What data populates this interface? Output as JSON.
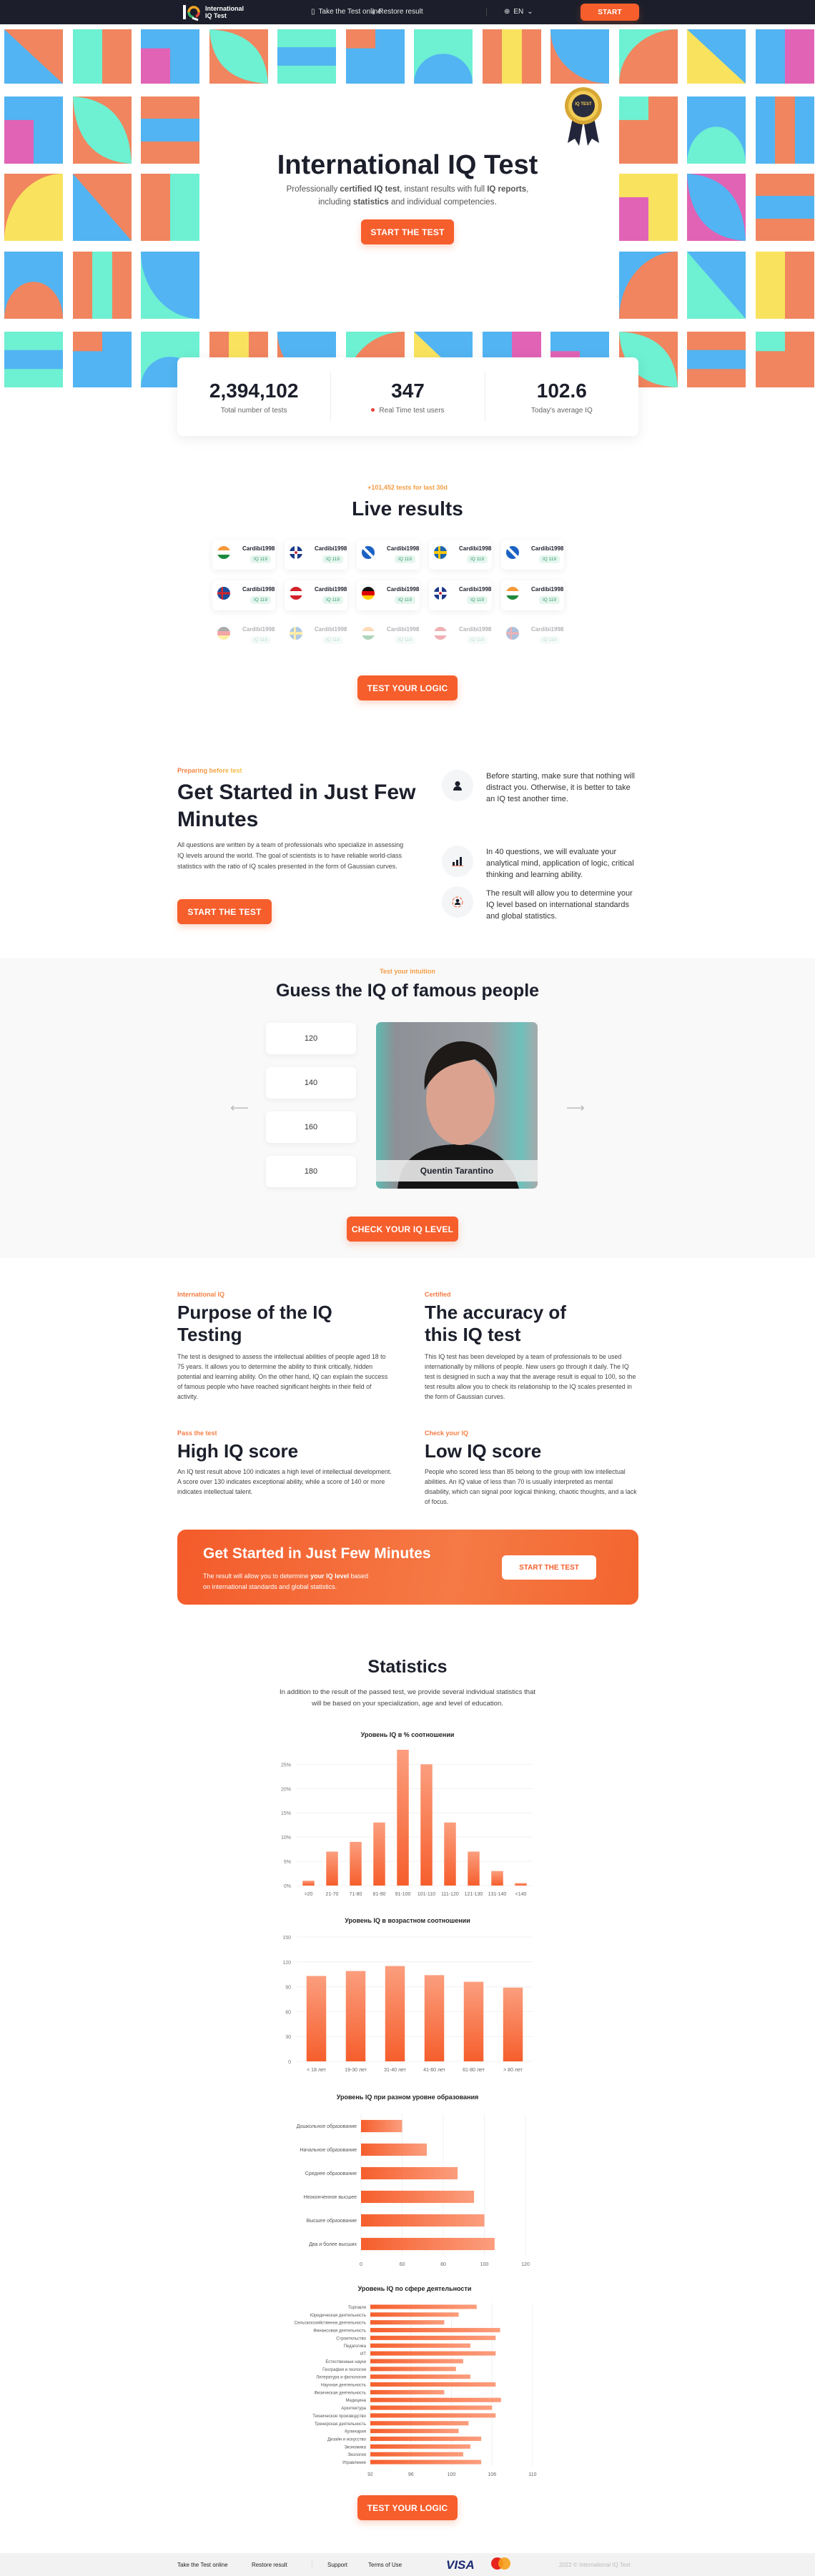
{
  "header": {
    "logo_text_line1": "International",
    "logo_text_line2": "IQ Test",
    "nav": [
      {
        "label": "Take the Test online",
        "icon": "clipboard-icon"
      },
      {
        "label": "Restore result",
        "icon": "download-icon"
      }
    ],
    "language": "EN",
    "start_label": "START",
    "bg_color": "#1c1f2b",
    "accent_color": "#f65e2c"
  },
  "hero": {
    "badge_text": "IQ TEST",
    "badge_top_text": "CERTIFIED",
    "title": "International IQ Test",
    "subtitle_parts": [
      "Professionally ",
      "certified IQ test",
      ", instant results with full ",
      "IQ reports",
      ",",
      "including ",
      "statistics",
      " and individual competencies."
    ],
    "cta_label": "START THE TEST",
    "tile_colors": [
      "#f0855f",
      "#52b4f2",
      "#6ef0d2",
      "#f9e35e",
      "#e063b5"
    ]
  },
  "stats": [
    {
      "value": "2,394,102",
      "label": "Total number of tests"
    },
    {
      "value": "347",
      "label": "Real Time test users",
      "live_dot": true
    },
    {
      "value": "102.6",
      "label": "Today's average IQ"
    }
  ],
  "live_results": {
    "eyebrow": "+101,452 tests for last 30d",
    "title": "Live results",
    "rows": [
      [
        {
          "flag": "india",
          "user": "Cardibi1998",
          "iq": "IQ 119"
        },
        {
          "flag": "uk",
          "user": "Cardibi1998",
          "iq": "IQ 119"
        },
        {
          "flag": "scotland",
          "user": "Cardibi1998",
          "iq": "IQ 119"
        },
        {
          "flag": "sweden",
          "user": "Cardibi1998",
          "iq": "IQ 119"
        },
        {
          "flag": "scotland",
          "user": "Cardibi1998",
          "iq": "IQ 119"
        }
      ],
      [
        {
          "flag": "aland",
          "user": "Cardibi1998",
          "iq": "IQ 119"
        },
        {
          "flag": "austria",
          "user": "Cardibi1998",
          "iq": "IQ 119"
        },
        {
          "flag": "germany",
          "user": "Cardibi1998",
          "iq": "IQ 119"
        },
        {
          "flag": "uk",
          "user": "Cardibi1998",
          "iq": "IQ 119"
        },
        {
          "flag": "india",
          "user": "Cardibi1998",
          "iq": "IQ 119"
        }
      ],
      [
        {
          "flag": "germany",
          "user": "Cardibi1998",
          "iq": "IQ 119"
        },
        {
          "flag": "sweden",
          "user": "Cardibi1998",
          "iq": "IQ 119"
        },
        {
          "flag": "india",
          "user": "Cardibi1998",
          "iq": "IQ 119"
        },
        {
          "flag": "austria",
          "user": "Cardibi1998",
          "iq": "IQ 119"
        },
        {
          "flag": "aland",
          "user": "Cardibi1998",
          "iq": "IQ 119"
        }
      ]
    ],
    "cta_label": "TEST YOUR LOGIC"
  },
  "get_started": {
    "eyebrow": "Preparing before test",
    "title": "Get Started in Just Few Minutes",
    "text": "All questions are written by a team of professionals who specialize in assessing IQ levels around the world. The goal of scientists is to have reliable world-class statistics with the ratio of IQ scales presented in the form of Gaussian curves.",
    "cta_label": "START THE TEST",
    "features": [
      {
        "icon": "person-icon",
        "text": "Before starting, make sure that nothing will distract you. Otherwise, it is better to take an IQ test another time."
      },
      {
        "icon": "bar-chart-icon",
        "text": "In 40 questions, we will evaluate your analytical mind, application of logic, critical thinking and learning ability."
      },
      {
        "icon": "target-person-icon",
        "text": "The result will allow you to determine your IQ level based on international standards and global statistics."
      }
    ]
  },
  "famous": {
    "eyebrow": "Test your intuition",
    "title": "Guess the IQ of famous people",
    "options": [
      "120",
      "140",
      "160",
      "180"
    ],
    "person_name": "Quentin Tarantino",
    "cta_label": "CHECK YOUR IQ LEVEL"
  },
  "info_blocks": [
    {
      "eyebrow": "International IQ",
      "title": "Purpose of the IQ Testing",
      "text": "The test is designed to assess the intellectual abilities of people aged 18 to 75 years. It allows you to determine the ability to think critically, hidden potential and learning ability. On the other hand, IQ can explain the success of famous people who have reached significant heights in their field of activity."
    },
    {
      "eyebrow": "Certified",
      "title": "The accuracy of this IQ test",
      "text": "This IQ test has been developed by a team of professionals to be used internationally by millions of people. New users go through it daily. The IQ test is designed in such a way that the average result is equal to 100, so the test results allow you to check its relationship to the IQ scales presented in the form of Gaussian curves."
    },
    {
      "eyebrow": "Pass the test",
      "title": "High IQ score",
      "text": "An IQ test result above 100 indicates a high level of intellectual development. A score over 130 indicates exceptional ability, while a score of 140 or more indicates intellectual talent."
    },
    {
      "eyebrow": "Check your IQ",
      "title": "Low IQ score",
      "text": "People who scored less than 85 belong to the group with low intellectual abilities. An IQ value of less than 70 is usually interpreted as mental disability, which can signal poor logical thinking, chaotic thoughts, and a lack of focus."
    }
  ],
  "cta_banner": {
    "title": "Get Started in Just Few Minutes",
    "text_parts": [
      "The result will allow you to determine ",
      "your IQ level",
      " based",
      "on international standards and global statistics."
    ],
    "button_label": "START THE TEST"
  },
  "statistics": {
    "title": "Statistics",
    "text": "In addition to the result of the passed test, we provide several individual statistics that will be based on your specialization, age and level of education.",
    "cta_label": "TEST YOUR LOGIC"
  },
  "chart_data": [
    {
      "type": "bar",
      "title": "Уровень IQ в % соотношении",
      "categories": [
        ">20",
        "21-70",
        "71-80",
        "81-90",
        "91-100",
        "101-110",
        "111-120",
        "121-130",
        "131-140",
        "<140"
      ],
      "values": [
        1,
        7,
        9,
        13,
        28,
        25,
        13,
        7,
        3,
        0.5
      ],
      "yticks": [
        "0%",
        "5%",
        "10%",
        "15%",
        "20%",
        "25%"
      ],
      "ylim": [
        0,
        28
      ],
      "grid": true,
      "bar_color": "#f65e2c"
    },
    {
      "type": "bar",
      "title": "Уровень IQ в возрастном соотношении",
      "categories": [
        "< 18 лет",
        "19-30 лет",
        "31-40 лет",
        "41-60 лет",
        "61-80 лет",
        "> 80 лет"
      ],
      "values": [
        103,
        109,
        115,
        104,
        96,
        89
      ],
      "yticks": [
        "0",
        "30",
        "60",
        "90",
        "120",
        "150"
      ],
      "ylim": [
        0,
        150
      ],
      "grid": true,
      "bar_color": "#f65e2c"
    },
    {
      "type": "bar",
      "orientation": "horizontal",
      "title": "Уровень IQ при разном уровне образования",
      "categories": [
        "Дошкольное образование",
        "Начальное образование",
        "Среднее образование",
        "Неоконченное высшее",
        "Высшее образование",
        "Два и более высших"
      ],
      "values": [
        60,
        72,
        87,
        95,
        100,
        105
      ],
      "xticks": [
        "0",
        "60",
        "80",
        "100",
        "120"
      ],
      "xlim": [
        40,
        120
      ],
      "grid": true,
      "bar_color": "#f65e2c"
    },
    {
      "type": "bar",
      "orientation": "horizontal",
      "title": "Уровень IQ по сфере деятельности",
      "categories": [
        "Торговля",
        "Юридическая деятельность",
        "Сельскохозяйственна деятельность",
        "Финансовая деятельность",
        "Строительство",
        "Педагогика",
        "ИТ",
        "Естественные науки",
        "География и геология",
        "Литература и филология",
        "Научная деятельность",
        "Физическая деятельность",
        "Медицина",
        "Архитектура",
        "Техническое производство",
        "Тренерская деятельность",
        "Кулинария",
        "Дизайн и искусство",
        "Экономика",
        "Экология",
        "Управление"
      ],
      "values": [
        103.8,
        101.8,
        100.2,
        106.4,
        105.9,
        103.1,
        105.9,
        102.3,
        101.5,
        103.1,
        105.9,
        100.2,
        106.5,
        105.5,
        105.9,
        102.9,
        101.8,
        104.3,
        103.1,
        102.3,
        104.3
      ],
      "xticks": [
        "92",
        "96",
        "100",
        "106",
        "110"
      ],
      "xlim": [
        92,
        110
      ],
      "grid": true,
      "bar_color": "#f65e2c"
    }
  ],
  "footer": {
    "links": [
      "Take the Test online",
      "Restore result",
      "Support",
      "Terms of Use"
    ],
    "payment": [
      "VISA",
      "mastercard"
    ],
    "copyright": "2022 © International IQ Test"
  }
}
